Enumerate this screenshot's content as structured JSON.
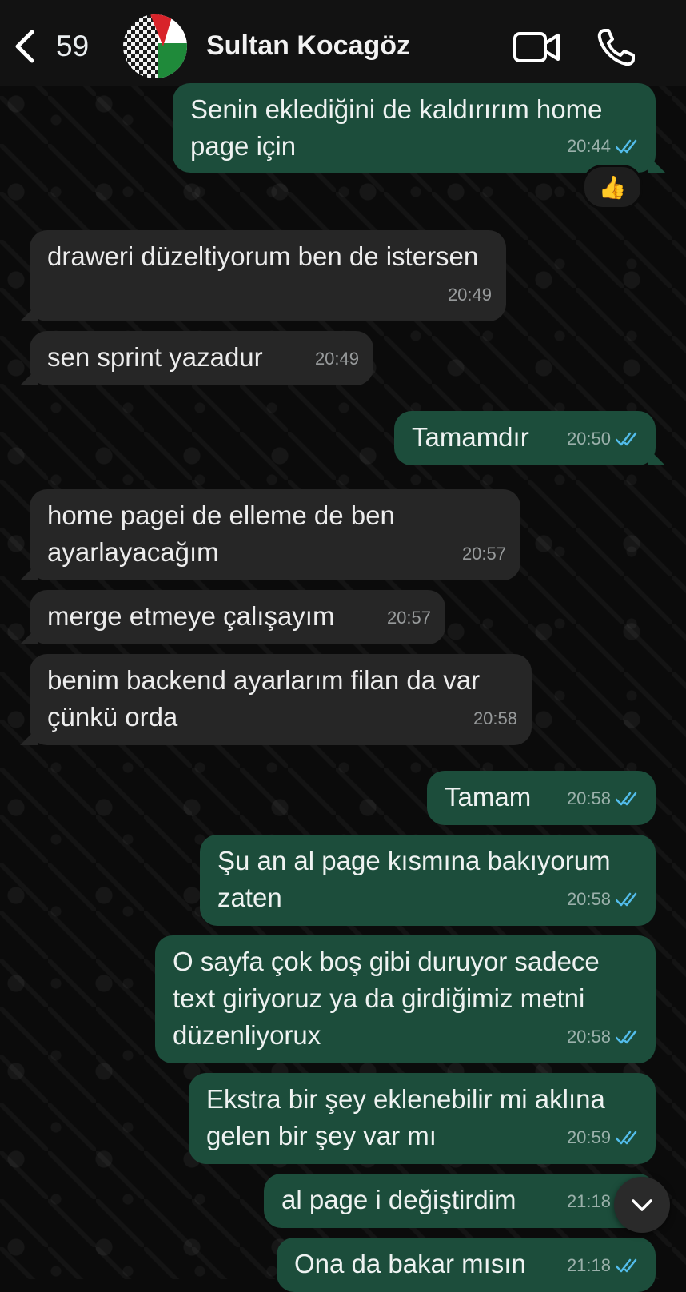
{
  "header": {
    "back_count": "59",
    "contact_name": "Sultan Kocagöz"
  },
  "messages": [
    {
      "dir": "out",
      "text": "Senin eklediğini de kaldırırım home page için",
      "time": "20:44",
      "reaction": "👍"
    },
    {
      "dir": "in",
      "text": "draweri düzeltiyorum ben de istersen",
      "time": "20:49"
    },
    {
      "dir": "in",
      "text": "sen sprint yazadur",
      "time": "20:49"
    },
    {
      "dir": "out",
      "text": "Tamamdır",
      "time": "20:50"
    },
    {
      "dir": "in",
      "text": "home pagei de elleme de ben ayarlayacağım",
      "time": "20:57"
    },
    {
      "dir": "in",
      "text": "merge etmeye çalışayım",
      "time": "20:57"
    },
    {
      "dir": "in",
      "text": "benim backend ayarlarım filan da var çünkü orda",
      "time": "20:58"
    },
    {
      "dir": "out",
      "text": "Tamam",
      "time": "20:58"
    },
    {
      "dir": "out",
      "text": "Şu an al page kısmına bakıyorum zaten",
      "time": "20:58"
    },
    {
      "dir": "out",
      "text": "O sayfa çok boş gibi duruyor sadece text giriyoruz ya da girdiğimiz metni düzenliyorux",
      "time": "20:58"
    },
    {
      "dir": "out",
      "text": "Ekstra bir şey eklenebilir mi aklına gelen bir şey var mı",
      "time": "20:59"
    },
    {
      "dir": "out",
      "text": "al page i değiştirdim",
      "time": "21:18"
    },
    {
      "dir": "out",
      "text": "Ona da bakar mısın",
      "time": "21:18"
    }
  ],
  "colors": {
    "outgoing_bubble": "#1c4d3b",
    "incoming_bubble": "#262626",
    "read_ticks": "#53bdeb",
    "header_bg": "#121212"
  }
}
